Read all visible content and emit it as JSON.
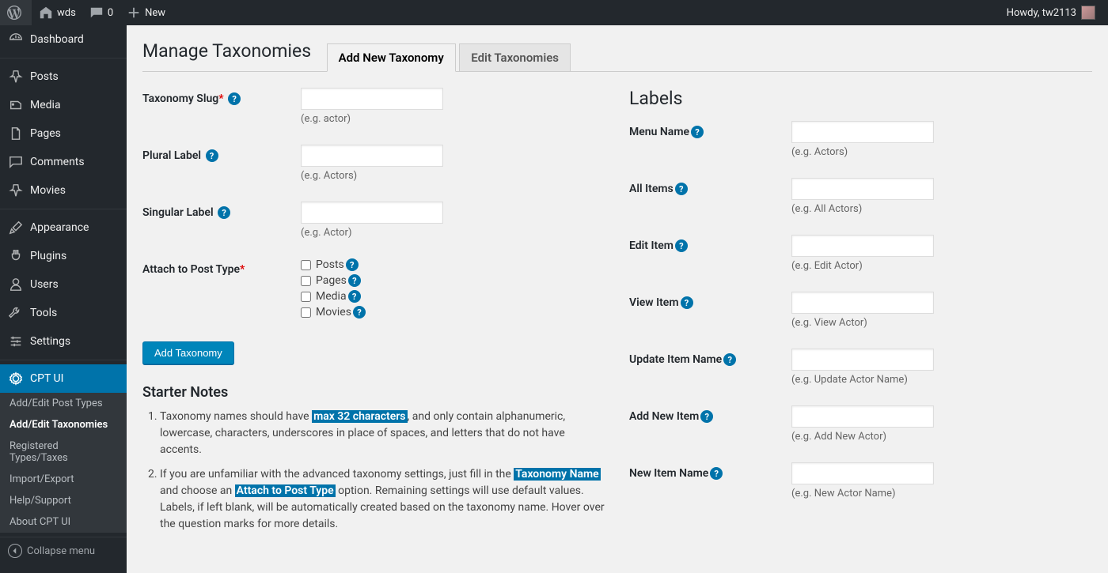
{
  "adminbar": {
    "site_name": "wds",
    "comments_count": "0",
    "new_label": "New",
    "greeting": "Howdy, tw2113"
  },
  "sidebar": {
    "items": [
      {
        "label": "Dashboard",
        "icon": "dashboard"
      },
      {
        "label": "Posts",
        "icon": "pin"
      },
      {
        "label": "Media",
        "icon": "media"
      },
      {
        "label": "Pages",
        "icon": "pages"
      },
      {
        "label": "Comments",
        "icon": "comment"
      },
      {
        "label": "Movies",
        "icon": "pin"
      },
      {
        "label": "Appearance",
        "icon": "brush"
      },
      {
        "label": "Plugins",
        "icon": "plug"
      },
      {
        "label": "Users",
        "icon": "user"
      },
      {
        "label": "Tools",
        "icon": "wrench"
      },
      {
        "label": "Settings",
        "icon": "sliders"
      },
      {
        "label": "CPT UI",
        "icon": "gear",
        "current": true
      }
    ],
    "submenu": [
      {
        "label": "Add/Edit Post Types"
      },
      {
        "label": "Add/Edit Taxonomies",
        "current": true
      },
      {
        "label": "Registered Types/Taxes"
      },
      {
        "label": "Import/Export"
      },
      {
        "label": "Help/Support"
      },
      {
        "label": "About CPT UI"
      }
    ],
    "collapse_label": "Collapse menu"
  },
  "page": {
    "title": "Manage Taxonomies",
    "tabs": [
      {
        "label": "Add New Taxonomy",
        "active": true
      },
      {
        "label": "Edit Taxonomies"
      }
    ],
    "labels_title": "Labels",
    "starter_notes_title": "Starter Notes",
    "submit_label": "Add Taxonomy"
  },
  "form_left": {
    "slug": {
      "label": "Taxonomy Slug",
      "required": true,
      "hint": "(e.g. actor)"
    },
    "plural": {
      "label": "Plural Label",
      "hint": "(e.g. Actors)"
    },
    "singular": {
      "label": "Singular Label",
      "hint": "(e.g. Actor)"
    },
    "attach": {
      "label": "Attach to Post Type",
      "required": true,
      "options": [
        "Posts",
        "Pages",
        "Media",
        "Movies"
      ]
    }
  },
  "form_right": [
    {
      "label": "Menu Name",
      "hint": "(e.g. Actors)"
    },
    {
      "label": "All Items",
      "hint": "(e.g. All Actors)"
    },
    {
      "label": "Edit Item",
      "hint": "(e.g. Edit Actor)"
    },
    {
      "label": "View Item",
      "hint": "(e.g. View Actor)"
    },
    {
      "label": "Update Item Name",
      "hint": "(e.g. Update Actor Name)"
    },
    {
      "label": "Add New Item",
      "hint": "(e.g. Add New Actor)"
    },
    {
      "label": "New Item Name",
      "hint": "(e.g. New Actor Name)"
    }
  ],
  "notes": {
    "n1_pre": "Taxonomy names should have ",
    "n1_hl": "max 32 characters",
    "n1_post": ", and only contain alphanumeric, lowercase, characters, underscores in place of spaces, and letters that do not have accents.",
    "n2_a": "If you are unfamiliar with the advanced taxonomy settings, just fill in the ",
    "n2_hl1": "Taxonomy Name",
    "n2_b": " and choose an ",
    "n2_hl2": "Attach to Post Type",
    "n2_c": " option. Remaining settings will use default values. Labels, if left blank, will be automatically created based on the taxonomy name. Hover over the question marks for more details."
  }
}
